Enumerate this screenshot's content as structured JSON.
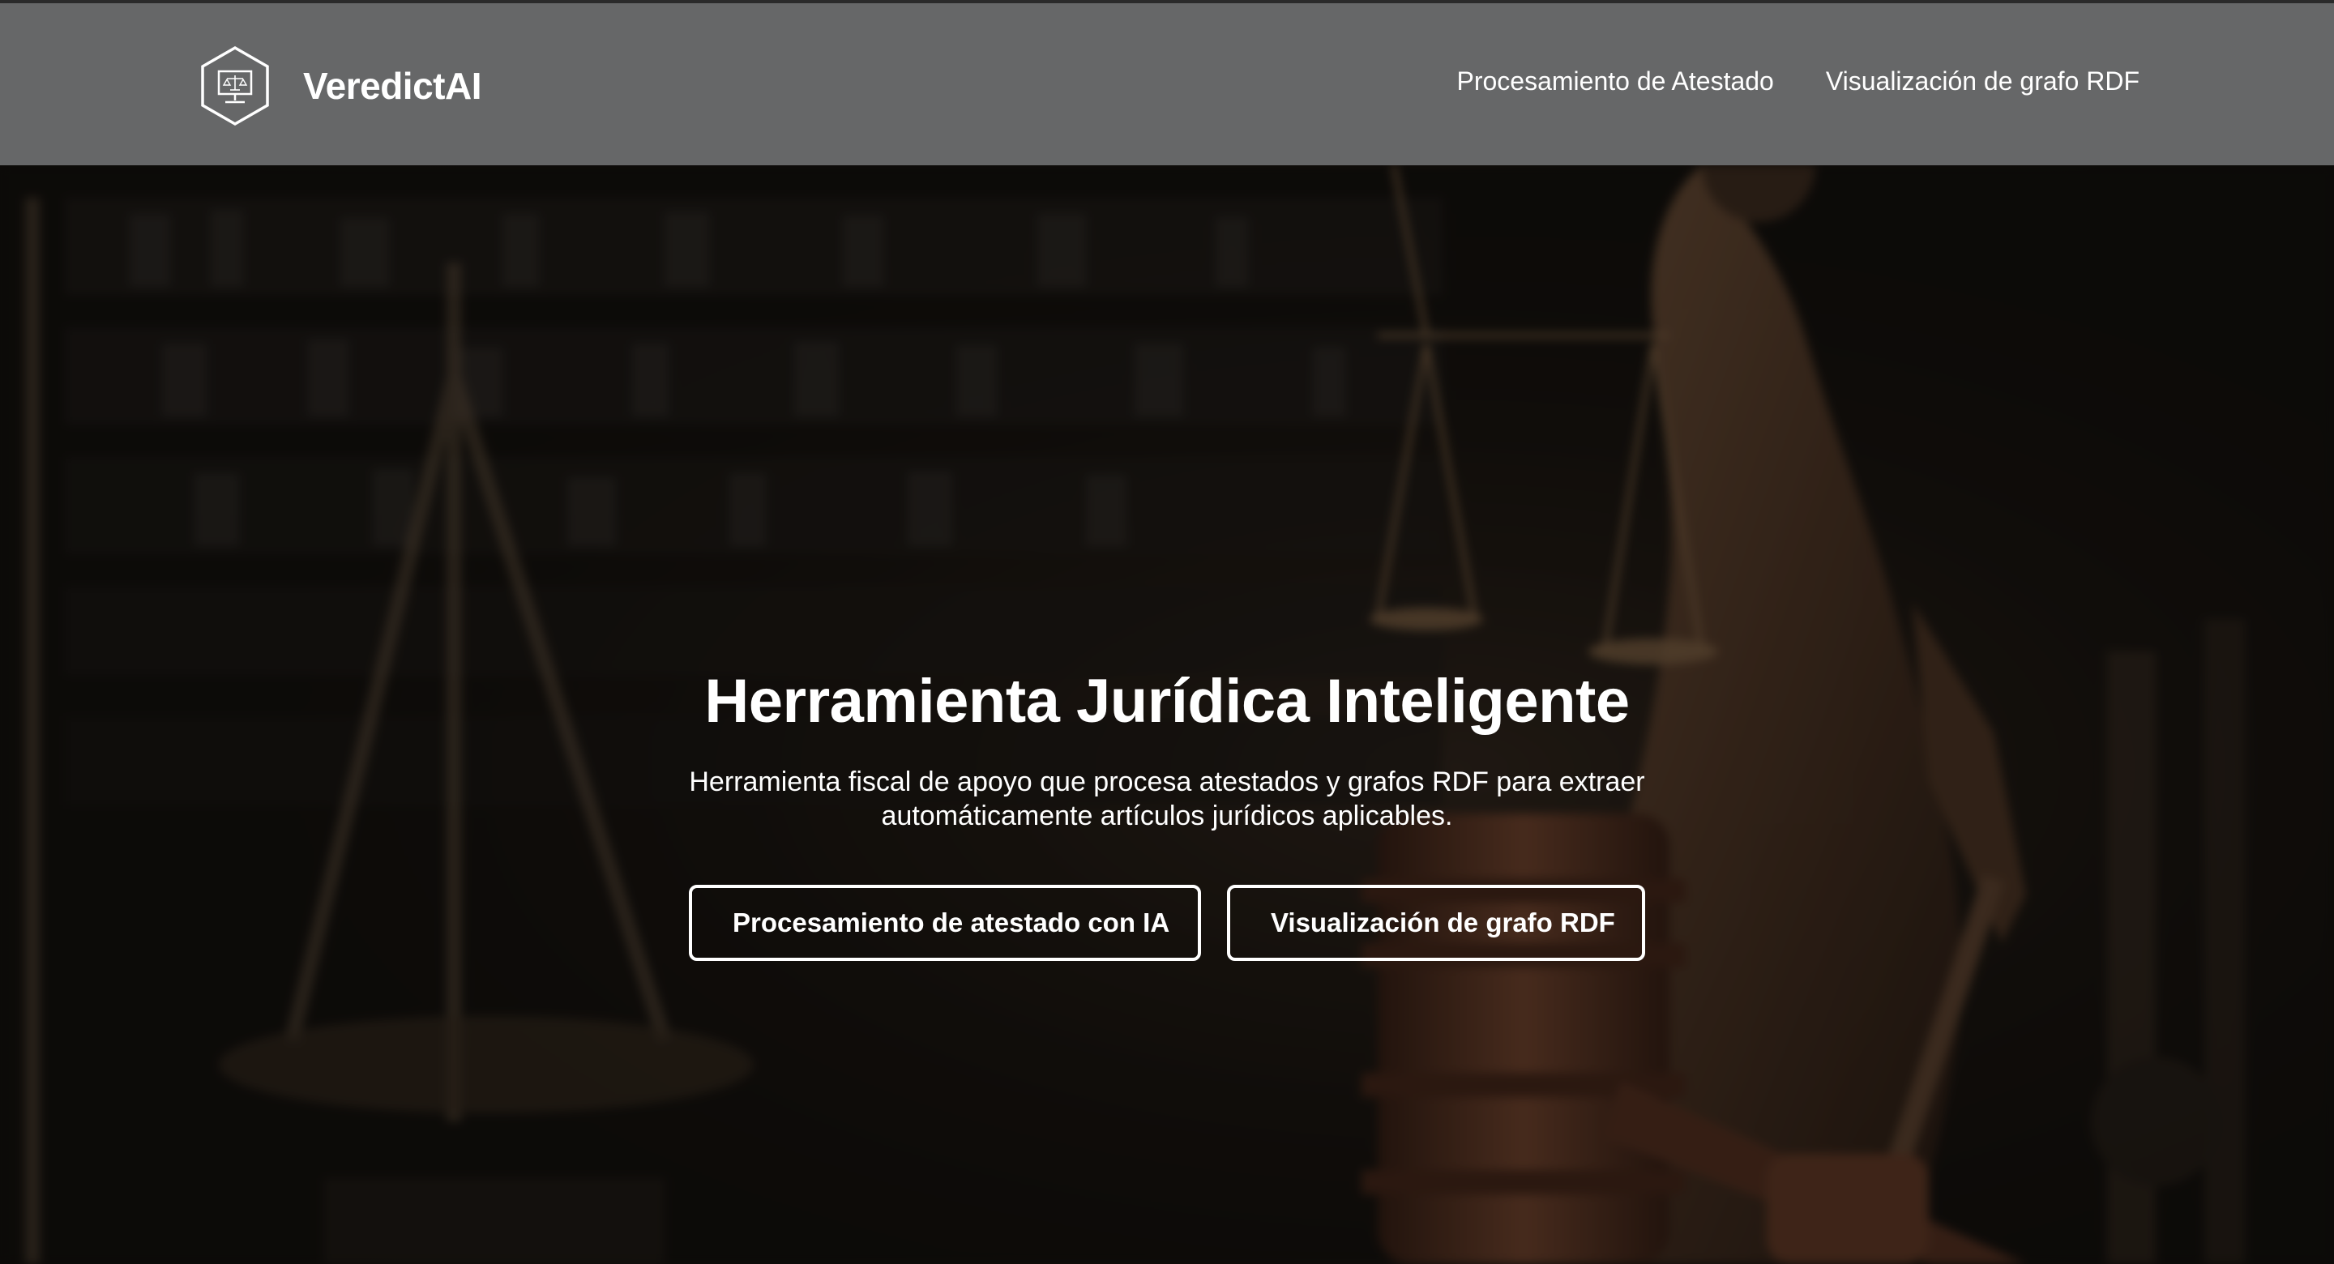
{
  "navbar": {
    "brand_name": "VeredictAI",
    "logo_icon": "monitor-in-hexagon-icon",
    "links": [
      {
        "label": "Procesamiento de Atestado"
      },
      {
        "label": "Visualización de grafo RDF"
      }
    ]
  },
  "hero": {
    "title": "Herramienta Jurídica Inteligente",
    "subtitle": "Herramienta fiscal de apoyo que procesa atestados y grafos RDF para extraer automáticamente artículos jurídicos aplicables.",
    "buttons": [
      {
        "label": "Procesamiento de atestado con IA"
      },
      {
        "label": "Visualización de grafo RDF"
      }
    ],
    "background_image": "blurred-courtroom-scales-of-justice-statue-gavel"
  },
  "colors": {
    "navbar_bg": "#666768",
    "text": "#ffffff",
    "hero_overlay": "rgba(0,0,0,0.42)",
    "bronze": "#6b4a33"
  }
}
